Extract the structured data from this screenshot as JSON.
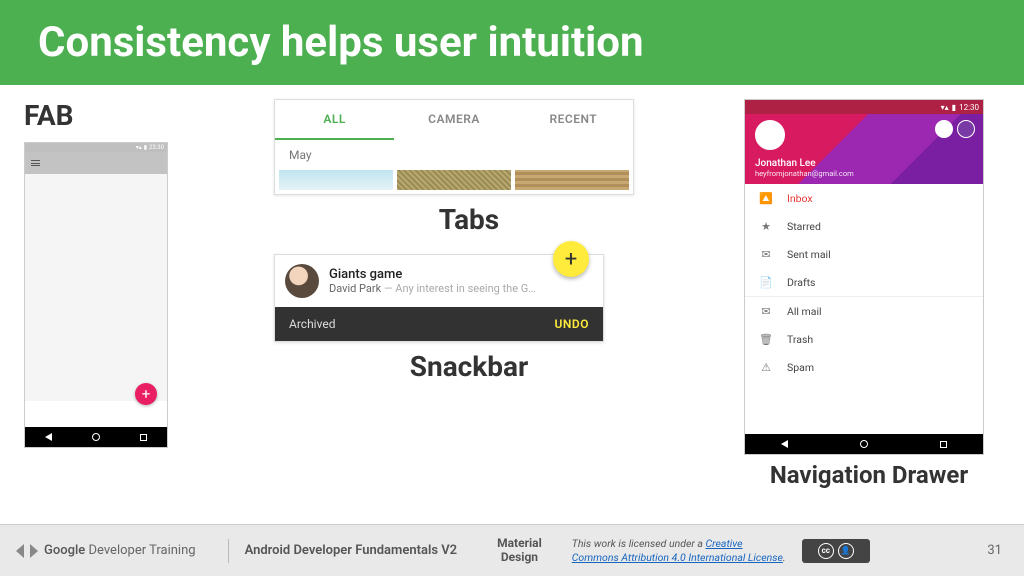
{
  "title": "Consistency helps user intuition",
  "fab": {
    "label": "FAB",
    "status_time": "23:30",
    "plus": "+"
  },
  "tabs": {
    "items": [
      "ALL",
      "CAMERA",
      "RECENT"
    ],
    "subheader": "May",
    "label": "Tabs"
  },
  "snackbar": {
    "title": "Giants game",
    "author": "David Park",
    "preview": " — Any interest in seeing the G…",
    "archived": "Archived",
    "undo": "UNDO",
    "plus": "+",
    "label": "Snackbar"
  },
  "drawer": {
    "status_time": "12:30",
    "name": "Jonathan Lee",
    "email": "heyfromjonathan@gmail.com",
    "items": [
      {
        "icon": "🔼",
        "label": "Inbox",
        "selected": true
      },
      {
        "icon": "★",
        "label": "Starred"
      },
      {
        "icon": "✉",
        "label": "Sent mail"
      },
      {
        "icon": "📄",
        "label": "Drafts"
      },
      {
        "divider": true
      },
      {
        "icon": "✉",
        "label": "All mail"
      },
      {
        "icon": "🗑",
        "label": "Trash"
      },
      {
        "icon": "⚠",
        "label": "Spam"
      }
    ],
    "label": "Navigation Drawer"
  },
  "footer": {
    "brand_strong": "Google",
    "brand_rest": " Developer Training",
    "course": "Android Developer Fundamentals V2",
    "topic1": "Material",
    "topic2": "Design",
    "license_pre": "This work is licensed under a ",
    "license_link": "Creative Commons Attribution 4.0 International License",
    "license_post": ".",
    "page": "31"
  }
}
